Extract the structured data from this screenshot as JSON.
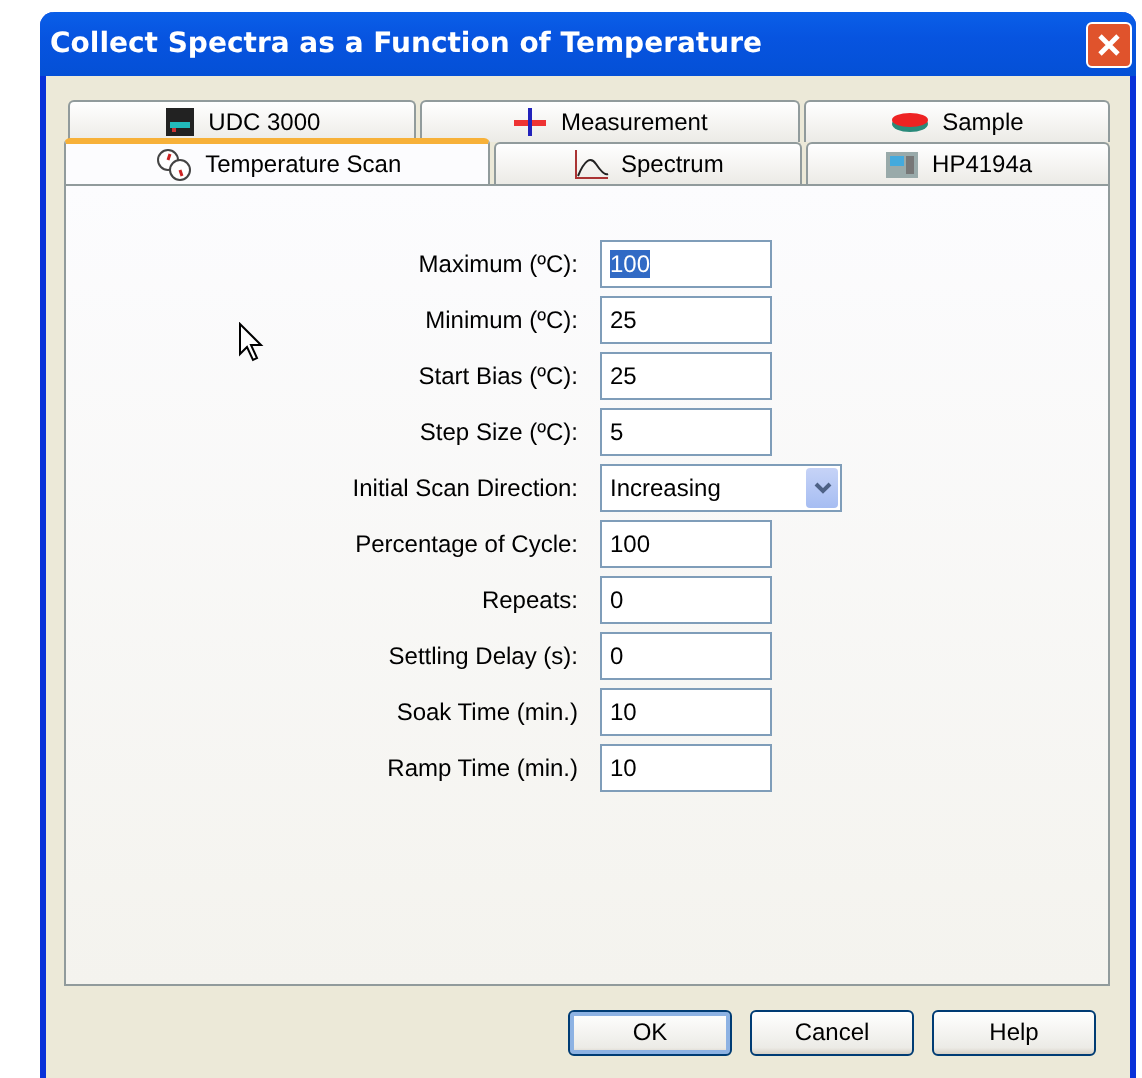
{
  "window": {
    "title": "Collect Spectra as a Function of Temperature"
  },
  "tab_rows": [
    {
      "tabs": [
        {
          "label": "UDC 3000",
          "selected": false
        },
        {
          "label": "Measurement",
          "selected": false
        },
        {
          "label": "Sample",
          "selected": false
        }
      ]
    },
    {
      "tabs": [
        {
          "label": "Temperature Scan",
          "selected": true
        },
        {
          "label": "Spectrum",
          "selected": false
        },
        {
          "label": "HP4194a",
          "selected": false
        }
      ]
    }
  ],
  "fields": [
    {
      "kind": "text",
      "label": "Maximum (ºC):",
      "value": "100",
      "highlighted": true
    },
    {
      "kind": "text",
      "label": "Minimum (ºC):",
      "value": "25",
      "highlighted": false
    },
    {
      "kind": "text",
      "label": "Start Bias (ºC):",
      "value": "25",
      "highlighted": false
    },
    {
      "kind": "text",
      "label": "Step Size (ºC):",
      "value": "5",
      "highlighted": false
    },
    {
      "kind": "dropdown",
      "label": "Initial Scan Direction:",
      "value": "Increasing",
      "highlighted": false
    },
    {
      "kind": "text",
      "label": "Percentage of Cycle:",
      "value": "100",
      "highlighted": false
    },
    {
      "kind": "text",
      "label": "Repeats:",
      "value": "0",
      "highlighted": false
    },
    {
      "kind": "text",
      "label": "Settling Delay (s):",
      "value": "0",
      "highlighted": false
    },
    {
      "kind": "text",
      "label": "Soak Time (min.)",
      "value": "10",
      "highlighted": false
    },
    {
      "kind": "text",
      "label": "Ramp Time (min.)",
      "value": "10",
      "highlighted": false
    }
  ],
  "buttons": [
    {
      "label": "OK",
      "default": true
    },
    {
      "label": "Cancel",
      "default": false
    },
    {
      "label": "Help",
      "default": false
    }
  ]
}
